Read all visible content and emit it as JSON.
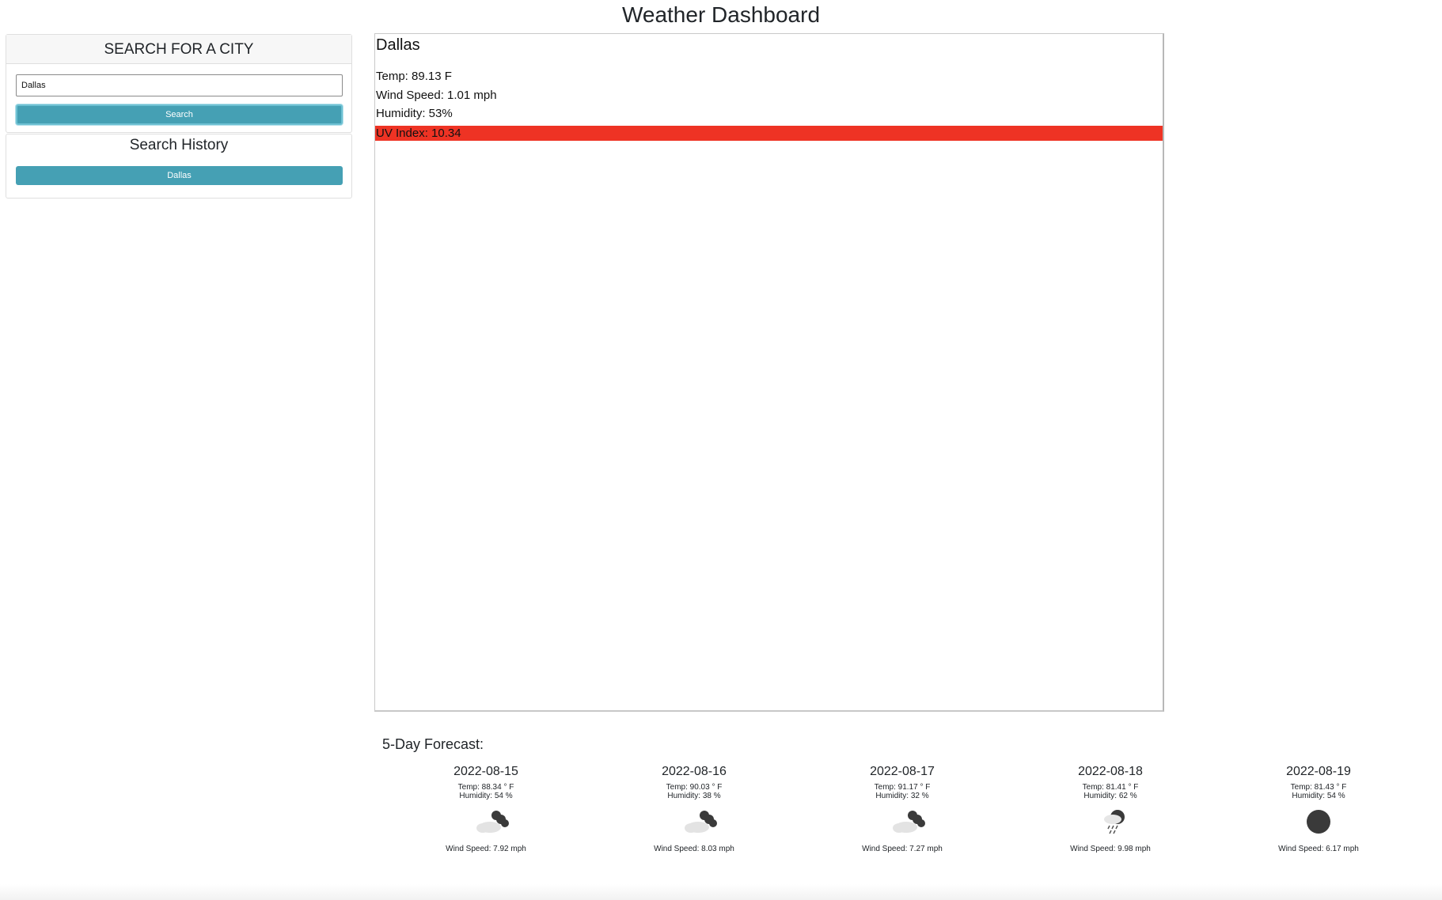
{
  "page": {
    "title": "Weather Dashboard"
  },
  "search": {
    "header": "SEARCH FOR A CITY",
    "input_value": "Dallas",
    "button_label": "Search"
  },
  "history": {
    "title": "Search History",
    "items": [
      "Dallas"
    ]
  },
  "current": {
    "city": "Dallas",
    "temp": "Temp: 89.13 F",
    "wind": "Wind Speed: 1.01 mph",
    "humidity": "Humidity: 53%",
    "uv": "UV Index: 10.34",
    "uv_color": "#ee3324"
  },
  "forecast": {
    "heading": "5-Day Forecast:",
    "days": [
      {
        "date": "2022-08-15",
        "temp": "Temp: 88.34 ° F",
        "humidity": "Humidity: 54 %",
        "icon": "partly-cloudy-icon",
        "wind": "Wind Speed: 7.92 mph"
      },
      {
        "date": "2022-08-16",
        "temp": "Temp: 90.03 ° F",
        "humidity": "Humidity: 38 %",
        "icon": "partly-cloudy-icon",
        "wind": "Wind Speed: 8.03 mph"
      },
      {
        "date": "2022-08-17",
        "temp": "Temp: 91.17 ° F",
        "humidity": "Humidity: 32 %",
        "icon": "partly-cloudy-icon",
        "wind": "Wind Speed: 7.27 mph"
      },
      {
        "date": "2022-08-18",
        "temp": "Temp: 81.41 ° F",
        "humidity": "Humidity: 62 %",
        "icon": "rain-icon",
        "wind": "Wind Speed: 9.98 mph"
      },
      {
        "date": "2022-08-19",
        "temp": "Temp: 81.43 ° F",
        "humidity": "Humidity: 54 %",
        "icon": "clear-night-icon",
        "wind": "Wind Speed: 6.17 mph"
      }
    ]
  },
  "colors": {
    "button": "#45a0b4",
    "uv_high": "#ee3324"
  }
}
